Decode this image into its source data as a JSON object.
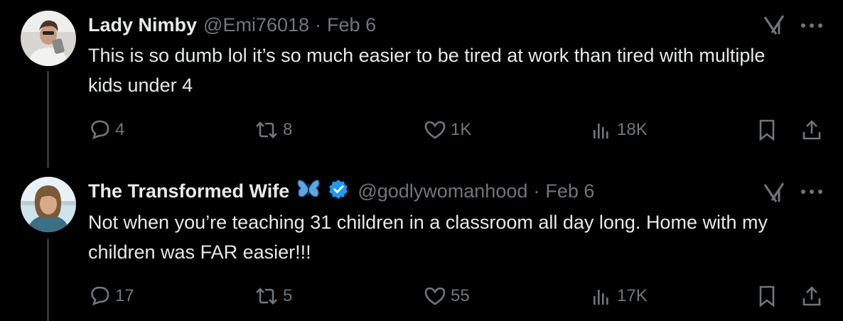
{
  "tweets": [
    {
      "author_name": "Lady Nimby",
      "handle": "@Emi76018",
      "separator": "·",
      "date": "Feb 6",
      "text": "This is so dumb lol it’s so much easier to be tired at work than tired with multiple kids under 4",
      "replies": "4",
      "retweets": "8",
      "likes": "1K",
      "views": "18K"
    },
    {
      "author_name": "The Transformed Wife",
      "handle": "@godlywomanhood",
      "separator": "·",
      "date": "Feb 6",
      "text": "Not when you’re teaching 31 children in a classroom all day long. Home with my children was FAR easier!!!",
      "replies": "17",
      "retweets": "5",
      "likes": "55",
      "views": "17K"
    }
  ],
  "icons": {
    "grok": "grok-icon",
    "more": "more-icon",
    "reply": "reply-icon",
    "retweet": "retweet-icon",
    "like": "heart-icon",
    "views": "views-icon",
    "bookmark": "bookmark-icon",
    "share": "share-icon",
    "verified": "verified-badge-icon",
    "butterfly": "butterfly-emoji-icon"
  },
  "colors": {
    "background": "#000000",
    "text": "#e7e9ea",
    "muted": "#71767b",
    "verified": "#1d9bf0"
  }
}
